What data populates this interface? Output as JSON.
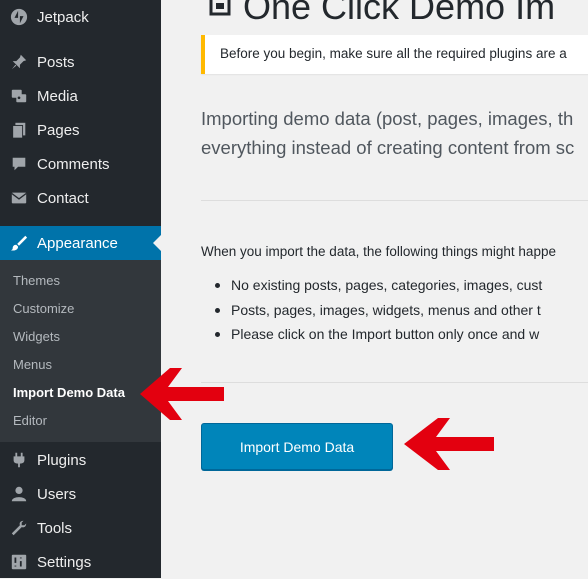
{
  "sidebar": {
    "top_item": {
      "label": "Jetpack",
      "icon": "jetpack-icon"
    },
    "items": [
      {
        "label": "Posts",
        "icon": "pushpin-icon"
      },
      {
        "label": "Media",
        "icon": "media-icon"
      },
      {
        "label": "Pages",
        "icon": "pages-icon"
      },
      {
        "label": "Comments",
        "icon": "comments-icon"
      },
      {
        "label": "Contact",
        "icon": "envelope-icon"
      },
      {
        "label": "Appearance",
        "icon": "paintbrush-icon",
        "active": true
      },
      {
        "label": "Plugins",
        "icon": "plugin-icon"
      },
      {
        "label": "Users",
        "icon": "users-icon"
      },
      {
        "label": "Tools",
        "icon": "wrench-icon"
      },
      {
        "label": "Settings",
        "icon": "settings-icon"
      }
    ],
    "submenu": [
      {
        "label": "Themes"
      },
      {
        "label": "Customize"
      },
      {
        "label": "Widgets"
      },
      {
        "label": "Menus"
      },
      {
        "label": "Import Demo Data",
        "current": true
      },
      {
        "label": "Editor"
      }
    ]
  },
  "main": {
    "title": "One Click Demo Im",
    "notice": "Before you begin, make sure all the required plugins are a",
    "intro_line1": "Importing demo data (post, pages, images, th",
    "intro_line2": "everything instead of creating content from sc",
    "things_intro": "When you import the data, the following things might happe",
    "bullets": [
      "No existing posts, pages, categories, images, cust",
      "Posts, pages, images, widgets, menus and other t",
      "Please click on the Import button only once and w"
    ],
    "import_button": "Import Demo Data"
  },
  "colors": {
    "sidebar_bg": "#23282d",
    "submenu_bg": "#32373c",
    "active_bg": "#0073aa",
    "button_bg": "#0085ba",
    "notice_border": "#ffb900",
    "annotation_arrow": "#e3000f"
  },
  "annotations": [
    {
      "type": "arrow",
      "points_to": "Import Demo Data submenu item",
      "color": "#e3000f"
    },
    {
      "type": "arrow",
      "points_to": "Import Demo Data button",
      "color": "#e3000f"
    }
  ]
}
